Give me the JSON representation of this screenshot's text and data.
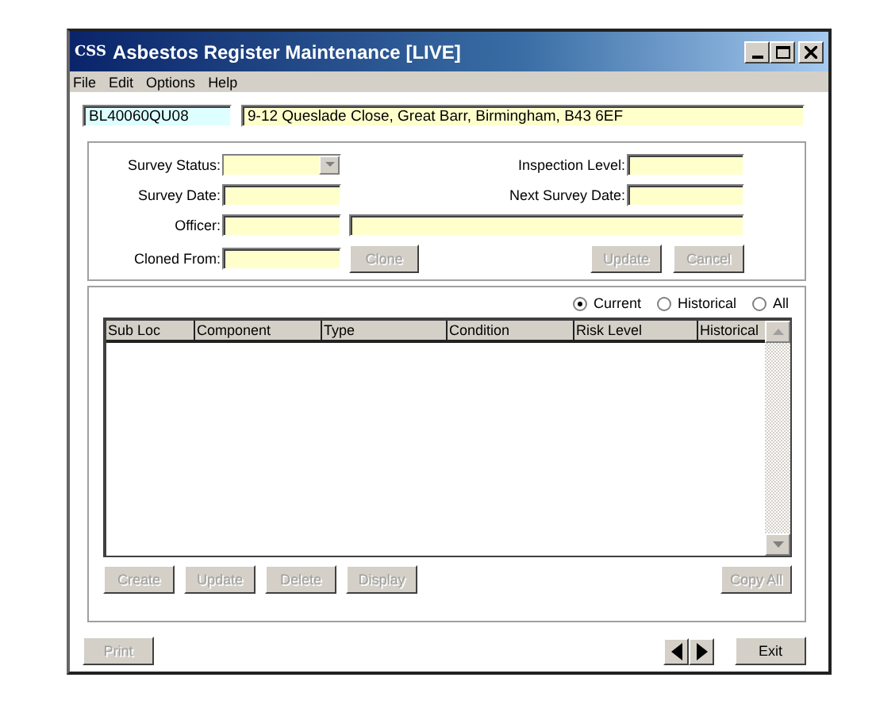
{
  "window": {
    "logo": "CSS",
    "title": "Asbestos Register Maintenance [LIVE]"
  },
  "menu": [
    "File",
    "Edit",
    "Options",
    "Help"
  ],
  "property": {
    "code": "BL40060QU08",
    "address": "9-12 Queslade Close, Great Barr, Birmingham, B43 6EF"
  },
  "survey": {
    "survey_status": "Survey Status:",
    "inspection_level": "Inspection Level:",
    "survey_date": "Survey Date:",
    "next_survey_date": "Next Survey Date:",
    "officer": "Officer:",
    "cloned_from": "Cloned From:",
    "clone_button": {
      "label": "Clone",
      "disabled": true
    },
    "update_button": {
      "label": "Update",
      "disabled": true
    },
    "cancel_button": {
      "label": "Cancel",
      "disabled": true
    }
  },
  "filter": [
    {
      "label": "Current",
      "selected": true
    },
    {
      "label": "Historical",
      "selected": false
    },
    {
      "label": "All",
      "selected": false
    }
  ],
  "table": {
    "columns": [
      "Sub Loc",
      "Component",
      "Type",
      "Condition",
      "Risk Level",
      "Historical"
    ]
  },
  "table_buttons": [
    {
      "label": "Create",
      "disabled": true
    },
    {
      "label": "Update",
      "disabled": true
    },
    {
      "label": "Delete",
      "disabled": true
    },
    {
      "label": "Display",
      "disabled": true
    }
  ],
  "copy_all": {
    "label": "Copy All",
    "disabled": true
  },
  "print": {
    "label": "Print",
    "disabled": true
  },
  "exit": {
    "label": "Exit",
    "disabled": false
  }
}
